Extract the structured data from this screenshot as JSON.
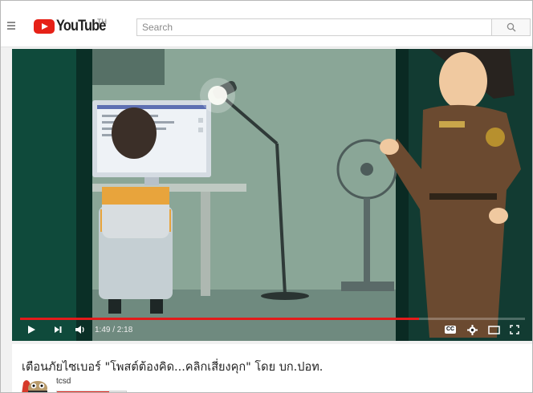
{
  "header": {
    "logo_text": "YouTube",
    "country_code": "TH",
    "search_placeholder": "Search"
  },
  "player": {
    "time_display": "1:49 / 2:18",
    "progress_fraction": 0.79,
    "buffer_fraction": 0.79,
    "icons": {
      "play": "play-icon",
      "next": "next-icon",
      "volume": "volume-icon",
      "captions": "captions-icon",
      "settings": "gear-icon",
      "theater": "theater-mode-icon",
      "fullscreen": "fullscreen-icon"
    },
    "captions_label": "CC"
  },
  "video": {
    "title": "เตือนภัยไซเบอร์ \"โพสต์ต้องคิด...คลิกเสี่ยงคุก\" โดย บก.ปอท.",
    "channel_name": "tcsd",
    "sub_bar_fraction": 0.75
  },
  "colors": {
    "brand_red": "#e62117",
    "progress_red": "#e31b1b"
  }
}
